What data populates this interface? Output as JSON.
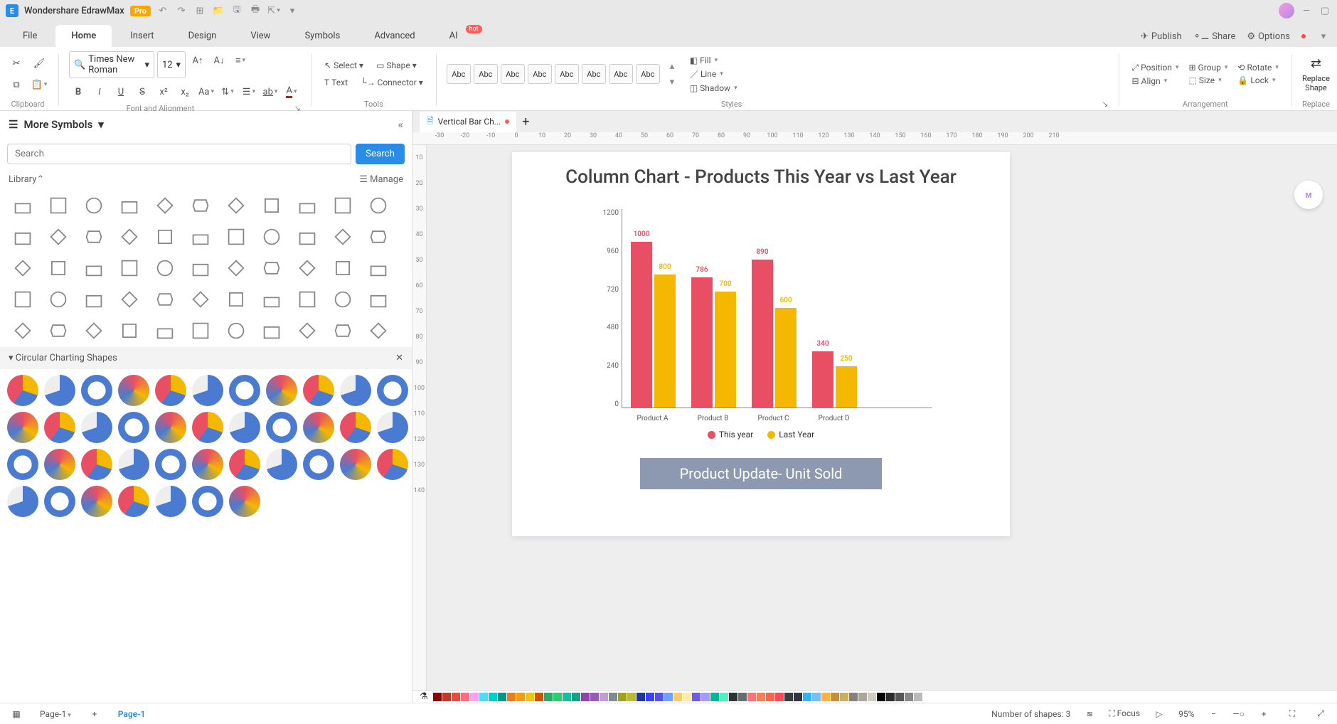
{
  "app": {
    "title": "Wondershare EdrawMax",
    "badge": "Pro"
  },
  "menu": {
    "tabs": [
      "File",
      "Home",
      "Insert",
      "Design",
      "View",
      "Symbols",
      "Advanced",
      "AI"
    ],
    "active": "Home",
    "hot_on": "AI",
    "right": {
      "publish": "Publish",
      "share": "Share",
      "options": "Options"
    }
  },
  "ribbon": {
    "font_name": "Times New Roman",
    "font_size": "12",
    "select": "Select",
    "shape": "Shape",
    "text": "Text",
    "connector": "Connector",
    "style_swatch": "Abc",
    "fill": "Fill",
    "line": "Line",
    "shadow": "Shadow",
    "position": "Position",
    "group": "Group",
    "rotate": "Rotate",
    "align": "Align",
    "size": "Size",
    "lock": "Lock",
    "replace_shape": "Replace\nShape",
    "groups": {
      "clipboard": "Clipboard",
      "font": "Font and Alignment",
      "tools": "Tools",
      "styles": "Styles",
      "arrangement": "Arrangement",
      "replace": "Replace"
    }
  },
  "sidebar": {
    "header": "More Symbols",
    "search_placeholder": "Search",
    "search_btn": "Search",
    "library": "Library",
    "manage": "Manage",
    "section": "Circular Charting Shapes"
  },
  "doc": {
    "tab": "Vertical Bar Ch..."
  },
  "ruler_h": [
    "-30",
    "-20",
    "-10",
    "0",
    "10",
    "20",
    "30",
    "40",
    "50",
    "60",
    "70",
    "80",
    "90",
    "100",
    "110",
    "120",
    "130",
    "140",
    "150",
    "160",
    "170",
    "180",
    "190",
    "200",
    "210"
  ],
  "ruler_v": [
    "10",
    "20",
    "30",
    "40",
    "50",
    "60",
    "70",
    "80",
    "90",
    "100",
    "110",
    "120",
    "130",
    "140"
  ],
  "chart_data": {
    "type": "bar",
    "title": "Column Chart - Products This Year vs Last Year",
    "subtitle": "Product Update- Unit Sold",
    "categories": [
      "Product A",
      "Product B",
      "Product C",
      "Product D"
    ],
    "series": [
      {
        "name": "This year",
        "color": "#e94f64",
        "values": [
          1000,
          786,
          890,
          340
        ]
      },
      {
        "name": "Last Year",
        "color": "#f5b800",
        "values": [
          800,
          700,
          600,
          250
        ]
      }
    ],
    "y_ticks": [
      1200,
      960,
      720,
      480,
      240,
      0
    ],
    "ylim": [
      0,
      1200
    ]
  },
  "colorbar": [
    "#8b0000",
    "#c0392b",
    "#e74c3c",
    "#ff6b81",
    "#ff9ff3",
    "#48dbfb",
    "#00cec9",
    "#009688",
    "#e67e22",
    "#f39c12",
    "#f1c40f",
    "#d35400",
    "#27ae60",
    "#2ecc71",
    "#1abc9c",
    "#16a085",
    "#8e44ad",
    "#9b59b6",
    "#c39bd3",
    "#7f8c8d",
    "#9fa21a",
    "#b8bc2e",
    "#1e3799",
    "#3742fa",
    "#5352ed",
    "#70a1ff",
    "#fdcb6e",
    "#ffeaa7",
    "#6c5ce7",
    "#a29bfe",
    "#00b894",
    "#55efc4",
    "#2d3436",
    "#636e72",
    "#fd7272",
    "#f97f51",
    "#ff6348",
    "#ff4757",
    "#3d3d3d",
    "#2f3542",
    "#34b3f1",
    "#74c0fc",
    "#ffb142",
    "#cc8e35",
    "#ccae62",
    "#84817a",
    "#aaa69d",
    "#d1ccc0",
    "#000000",
    "#2c2c2c",
    "#555555",
    "#888888",
    "#bbbbbb",
    "#ffffff"
  ],
  "status": {
    "page_dropdown": "Page-1",
    "page_current": "Page-1",
    "shape_count": "Number of shapes: 3",
    "focus": "Focus",
    "zoom": "95%"
  }
}
